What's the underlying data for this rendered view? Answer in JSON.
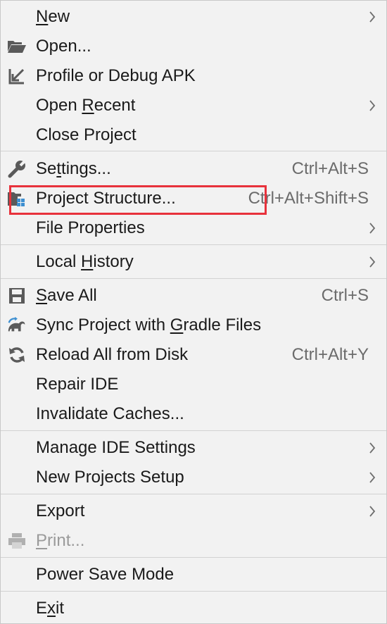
{
  "menu": {
    "items": [
      {
        "label_pre": "",
        "mn": "N",
        "label_post": "ew",
        "shortcut": "",
        "submenu": true,
        "icon": ""
      },
      {
        "label_pre": "Open...",
        "mn": "",
        "label_post": "",
        "shortcut": "",
        "submenu": false,
        "icon": "folder-open-icon"
      },
      {
        "label_pre": "Profile or Debug APK",
        "mn": "",
        "label_post": "",
        "shortcut": "",
        "submenu": false,
        "icon": "import-arrow-icon"
      },
      {
        "label_pre": "Open ",
        "mn": "R",
        "label_post": "ecent",
        "shortcut": "",
        "submenu": true,
        "icon": ""
      },
      {
        "label_pre": "Close Project",
        "mn": "",
        "label_post": "",
        "shortcut": "",
        "submenu": false,
        "icon": ""
      },
      {
        "label_pre": "Se",
        "mn": "t",
        "label_post": "tings...",
        "shortcut": "Ctrl+Alt+S",
        "submenu": false,
        "icon": "wrench-icon"
      },
      {
        "label_pre": "Project Structure...",
        "mn": "",
        "label_post": "",
        "shortcut": "Ctrl+Alt+Shift+S",
        "submenu": false,
        "icon": "project-structure-icon"
      },
      {
        "label_pre": "File Properties",
        "mn": "",
        "label_post": "",
        "shortcut": "",
        "submenu": true,
        "icon": ""
      },
      {
        "label_pre": "Local ",
        "mn": "H",
        "label_post": "istory",
        "shortcut": "",
        "submenu": true,
        "icon": ""
      },
      {
        "label_pre": "",
        "mn": "S",
        "label_post": "ave All",
        "shortcut": "Ctrl+S",
        "submenu": false,
        "icon": "save-icon"
      },
      {
        "label_pre": "Sync Project with ",
        "mn": "G",
        "label_post": "radle Files",
        "shortcut": "",
        "submenu": false,
        "icon": "gradle-sync-icon"
      },
      {
        "label_pre": "Reload All from Disk",
        "mn": "",
        "label_post": "",
        "shortcut": "Ctrl+Alt+Y",
        "submenu": false,
        "icon": "reload-icon"
      },
      {
        "label_pre": "Repair IDE",
        "mn": "",
        "label_post": "",
        "shortcut": "",
        "submenu": false,
        "icon": ""
      },
      {
        "label_pre": "Invalidate Caches...",
        "mn": "",
        "label_post": "",
        "shortcut": "",
        "submenu": false,
        "icon": ""
      },
      {
        "label_pre": "Manage IDE Settings",
        "mn": "",
        "label_post": "",
        "shortcut": "",
        "submenu": true,
        "icon": ""
      },
      {
        "label_pre": "New Projects Setup",
        "mn": "",
        "label_post": "",
        "shortcut": "",
        "submenu": true,
        "icon": ""
      },
      {
        "label_pre": "Export",
        "mn": "",
        "label_post": "",
        "shortcut": "",
        "submenu": true,
        "icon": ""
      },
      {
        "label_pre": "",
        "mn": "P",
        "label_post": "rint...",
        "shortcut": "",
        "submenu": false,
        "icon": "print-icon",
        "disabled": true
      },
      {
        "label_pre": "Power Save Mode",
        "mn": "",
        "label_post": "",
        "shortcut": "",
        "submenu": false,
        "icon": ""
      },
      {
        "label_pre": "E",
        "mn": "x",
        "label_post": "it",
        "shortcut": "",
        "submenu": false,
        "icon": ""
      }
    ]
  },
  "colors": {
    "menu_background": "#f2f2f2",
    "separator": "#d2d2d2",
    "shortcut_text": "#6b6b6b",
    "highlight_border": "#e8323c"
  }
}
